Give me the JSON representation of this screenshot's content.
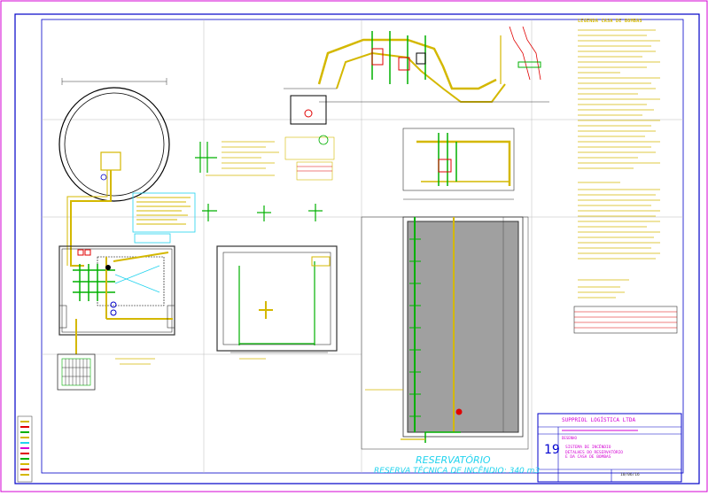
{
  "title_block": {
    "company": "SUPPRIOL LOGÍSTICA LTDA",
    "drawing_label": "DESENHO",
    "sheet_number": "19",
    "drawing_title": "SISTEMA DE INCÊNDIO\nDETALHES DO RESERVATÓRIO\nE DA CASA DE BOMBAS",
    "date": "10/06/16"
  },
  "legend": {
    "title": "LEGENDA CASA DE BOMBAS"
  },
  "reservoir": {
    "title": "RESERVATÓRIO",
    "subtitle": "RESERVA TÉCNICA DE INCÊNDIO: 340 m3"
  },
  "colors": {
    "frame": "#0000c8",
    "pipe": "#d4b800",
    "wall": "#d400d4",
    "green": "#00b000",
    "cyan": "#22d3ee",
    "red": "#e00000",
    "fill": "#a0a0a0"
  }
}
